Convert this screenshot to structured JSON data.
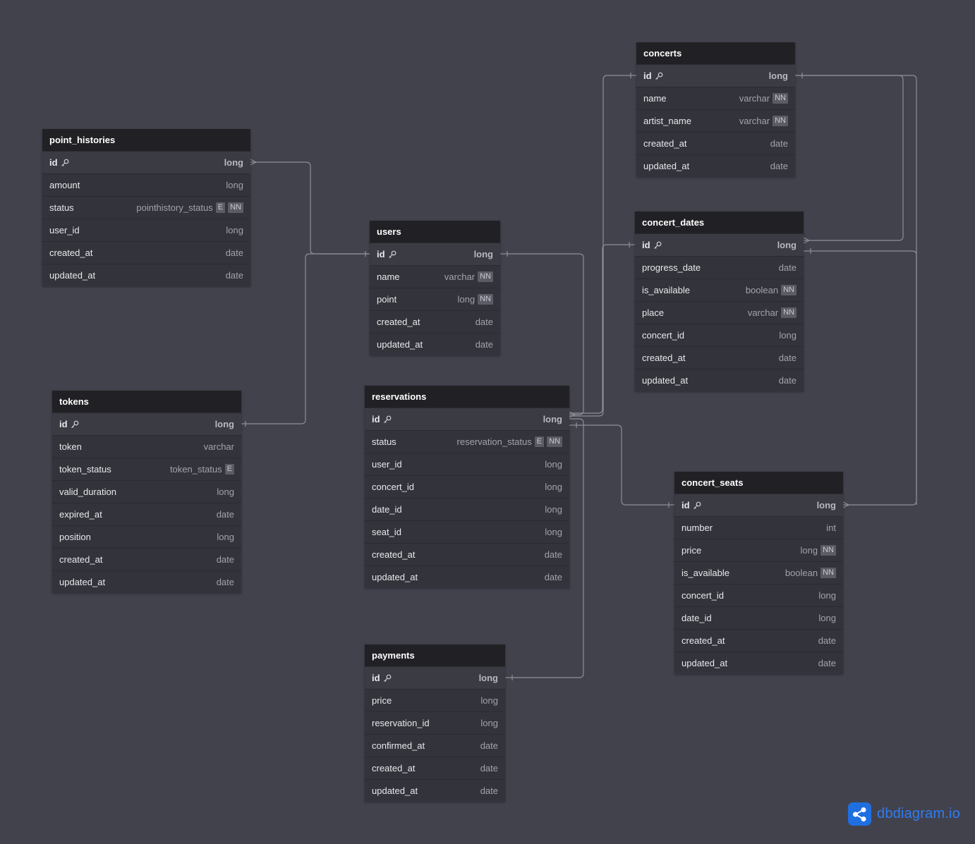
{
  "logo": {
    "text": "dbdiagram.io",
    "accent_color": "#1f6fe0"
  },
  "tables": [
    {
      "id": "point_histories",
      "name": "point_histories",
      "fields": [
        {
          "name": "id",
          "type": "long",
          "pk": true,
          "badges": []
        },
        {
          "name": "amount",
          "type": "long",
          "badges": []
        },
        {
          "name": "status",
          "type": "pointhistory_status",
          "badges": [
            "E",
            "NN"
          ]
        },
        {
          "name": "user_id",
          "type": "long",
          "badges": []
        },
        {
          "name": "created_at",
          "type": "date",
          "badges": []
        },
        {
          "name": "updated_at",
          "type": "date",
          "badges": []
        }
      ]
    },
    {
      "id": "tokens",
      "name": "tokens",
      "fields": [
        {
          "name": "id",
          "type": "long",
          "pk": true,
          "badges": []
        },
        {
          "name": "token",
          "type": "varchar",
          "badges": []
        },
        {
          "name": "token_status",
          "type": "token_status",
          "badges": [
            "E"
          ]
        },
        {
          "name": "valid_duration",
          "type": "long",
          "badges": []
        },
        {
          "name": "expired_at",
          "type": "date",
          "badges": []
        },
        {
          "name": "position",
          "type": "long",
          "badges": []
        },
        {
          "name": "created_at",
          "type": "date",
          "badges": []
        },
        {
          "name": "updated_at",
          "type": "date",
          "badges": []
        }
      ]
    },
    {
      "id": "users",
      "name": "users",
      "fields": [
        {
          "name": "id",
          "type": "long",
          "pk": true,
          "badges": []
        },
        {
          "name": "name",
          "type": "varchar",
          "badges": [
            "NN"
          ]
        },
        {
          "name": "point",
          "type": "long",
          "badges": [
            "NN"
          ]
        },
        {
          "name": "created_at",
          "type": "date",
          "badges": []
        },
        {
          "name": "updated_at",
          "type": "date",
          "badges": []
        }
      ]
    },
    {
      "id": "reservations",
      "name": "reservations",
      "fields": [
        {
          "name": "id",
          "type": "long",
          "pk": true,
          "badges": []
        },
        {
          "name": "status",
          "type": "reservation_status",
          "badges": [
            "E",
            "NN"
          ]
        },
        {
          "name": "user_id",
          "type": "long",
          "badges": []
        },
        {
          "name": "concert_id",
          "type": "long",
          "badges": []
        },
        {
          "name": "date_id",
          "type": "long",
          "badges": []
        },
        {
          "name": "seat_id",
          "type": "long",
          "badges": []
        },
        {
          "name": "created_at",
          "type": "date",
          "badges": []
        },
        {
          "name": "updated_at",
          "type": "date",
          "badges": []
        }
      ]
    },
    {
      "id": "payments",
      "name": "payments",
      "fields": [
        {
          "name": "id",
          "type": "long",
          "pk": true,
          "badges": []
        },
        {
          "name": "price",
          "type": "long",
          "badges": []
        },
        {
          "name": "reservation_id",
          "type": "long",
          "badges": []
        },
        {
          "name": "confirmed_at",
          "type": "date",
          "badges": []
        },
        {
          "name": "created_at",
          "type": "date",
          "badges": []
        },
        {
          "name": "updated_at",
          "type": "date",
          "badges": []
        }
      ]
    },
    {
      "id": "concerts",
      "name": "concerts",
      "fields": [
        {
          "name": "id",
          "type": "long",
          "pk": true,
          "badges": []
        },
        {
          "name": "name",
          "type": "varchar",
          "badges": [
            "NN"
          ]
        },
        {
          "name": "artist_name",
          "type": "varchar",
          "badges": [
            "NN"
          ]
        },
        {
          "name": "created_at",
          "type": "date",
          "badges": []
        },
        {
          "name": "updated_at",
          "type": "date",
          "badges": []
        }
      ]
    },
    {
      "id": "concert_dates",
      "name": "concert_dates",
      "fields": [
        {
          "name": "id",
          "type": "long",
          "pk": true,
          "badges": []
        },
        {
          "name": "progress_date",
          "type": "date",
          "badges": []
        },
        {
          "name": "is_available",
          "type": "boolean",
          "badges": [
            "NN"
          ]
        },
        {
          "name": "place",
          "type": "varchar",
          "badges": [
            "NN"
          ]
        },
        {
          "name": "concert_id",
          "type": "long",
          "badges": []
        },
        {
          "name": "created_at",
          "type": "date",
          "badges": []
        },
        {
          "name": "updated_at",
          "type": "date",
          "badges": []
        }
      ]
    },
    {
      "id": "concert_seats",
      "name": "concert_seats",
      "fields": [
        {
          "name": "id",
          "type": "long",
          "pk": true,
          "badges": []
        },
        {
          "name": "number",
          "type": "int",
          "badges": []
        },
        {
          "name": "price",
          "type": "long",
          "badges": [
            "NN"
          ]
        },
        {
          "name": "is_available",
          "type": "boolean",
          "badges": [
            "NN"
          ]
        },
        {
          "name": "concert_id",
          "type": "long",
          "badges": []
        },
        {
          "name": "date_id",
          "type": "long",
          "badges": []
        },
        {
          "name": "created_at",
          "type": "date",
          "badges": []
        },
        {
          "name": "updated_at",
          "type": "date",
          "badges": []
        }
      ]
    }
  ]
}
